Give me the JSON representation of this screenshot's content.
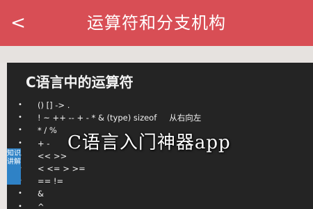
{
  "header": {
    "back_icon": "chevron-left-icon",
    "back_glyph": "<",
    "title": "运算符和分支机构"
  },
  "slide": {
    "title": "C语言中的运算符",
    "bullet": "•",
    "items": [
      {
        "text": "() [] -> .",
        "note": ""
      },
      {
        "text": "! ~ ++ -- + - * & (type) sizeof",
        "note": "从右向左"
      },
      {
        "text": "* / %",
        "note": ""
      },
      {
        "text": "+ -",
        "note": ""
      },
      {
        "text": "<< >>",
        "note": ""
      },
      {
        "text": "< <= > >=",
        "note": ""
      },
      {
        "text": "== !=",
        "note": ""
      },
      {
        "text": "&",
        "note": ""
      },
      {
        "text": "^",
        "note": ""
      }
    ]
  },
  "side_tab": {
    "label_line1": "知识",
    "label_line2": "讲解",
    "color": "#2f82c6"
  },
  "watermark": {
    "text": "C语言入门神器app"
  },
  "colors": {
    "header": "#d84e55",
    "slide_bg": "#242424"
  }
}
